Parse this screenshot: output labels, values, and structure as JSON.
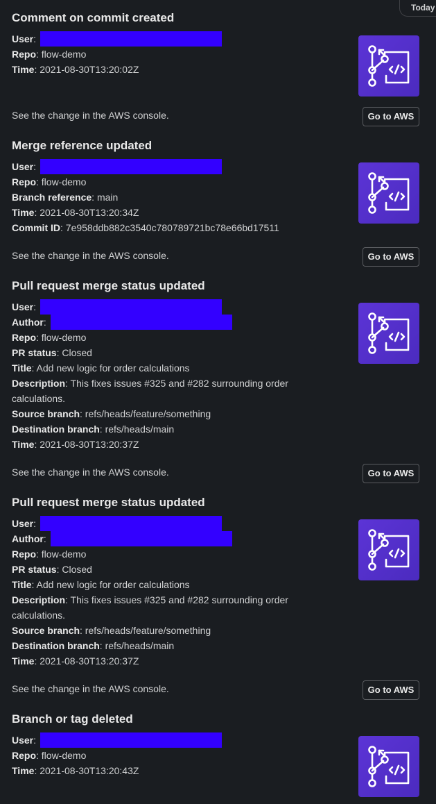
{
  "day_divider": "Today",
  "footer_text": "See the change in the AWS console.",
  "button_label": "Go to AWS",
  "messages": [
    {
      "title": "Comment on commit created",
      "fields": [
        {
          "k": "User",
          "v": ""
        },
        {
          "k": "Repo",
          "v": ": flow-demo"
        },
        {
          "k": "Time",
          "v": ": 2021-08-30T13:20:02Z"
        }
      ]
    },
    {
      "title": "Merge reference updated",
      "fields": [
        {
          "k": "User",
          "v": ""
        },
        {
          "k": "Repo",
          "v": ": flow-demo"
        },
        {
          "k": "Branch reference",
          "v": ": main"
        },
        {
          "k": "Time",
          "v": ": 2021-08-30T13:20:34Z"
        },
        {
          "k": "Commit ID",
          "v": ": 7e958ddb882c3540c780789721bc78e66bd17511"
        }
      ]
    },
    {
      "title": "Pull request merge status updated",
      "fields": [
        {
          "k": "User",
          "v": ""
        },
        {
          "k": "Author",
          "v": ""
        },
        {
          "k": "Repo",
          "v": ": flow-demo"
        },
        {
          "k": "PR status",
          "v": ": Closed"
        },
        {
          "k": "Title",
          "v": ": Add new logic for order calculations"
        },
        {
          "k": "Description",
          "v": ": This fixes issues #325 and #282 surrounding order calculations."
        },
        {
          "k": "Source branch",
          "v": ": refs/heads/feature/something"
        },
        {
          "k": "Destination branch",
          "v": ": refs/heads/main"
        },
        {
          "k": "Time",
          "v": ": 2021-08-30T13:20:37Z"
        }
      ]
    },
    {
      "title": "Pull request merge status updated",
      "fields": [
        {
          "k": "User",
          "v": ""
        },
        {
          "k": "Author",
          "v": ""
        },
        {
          "k": "Repo",
          "v": ": flow-demo"
        },
        {
          "k": "PR status",
          "v": ": Closed"
        },
        {
          "k": "Title",
          "v": ": Add new logic for order calculations"
        },
        {
          "k": "Description",
          "v": ": This fixes issues #325 and #282 surrounding order calculations."
        },
        {
          "k": "Source branch",
          "v": ": refs/heads/feature/something"
        },
        {
          "k": "Destination branch",
          "v": ": refs/heads/main"
        },
        {
          "k": "Time",
          "v": ": 2021-08-30T13:20:37Z"
        }
      ]
    },
    {
      "title": "Branch or tag deleted",
      "fields": [
        {
          "k": "User",
          "v": ""
        },
        {
          "k": "Repo",
          "v": ": flow-demo"
        },
        {
          "k": "Time",
          "v": ": 2021-08-30T13:20:43Z"
        }
      ]
    }
  ]
}
